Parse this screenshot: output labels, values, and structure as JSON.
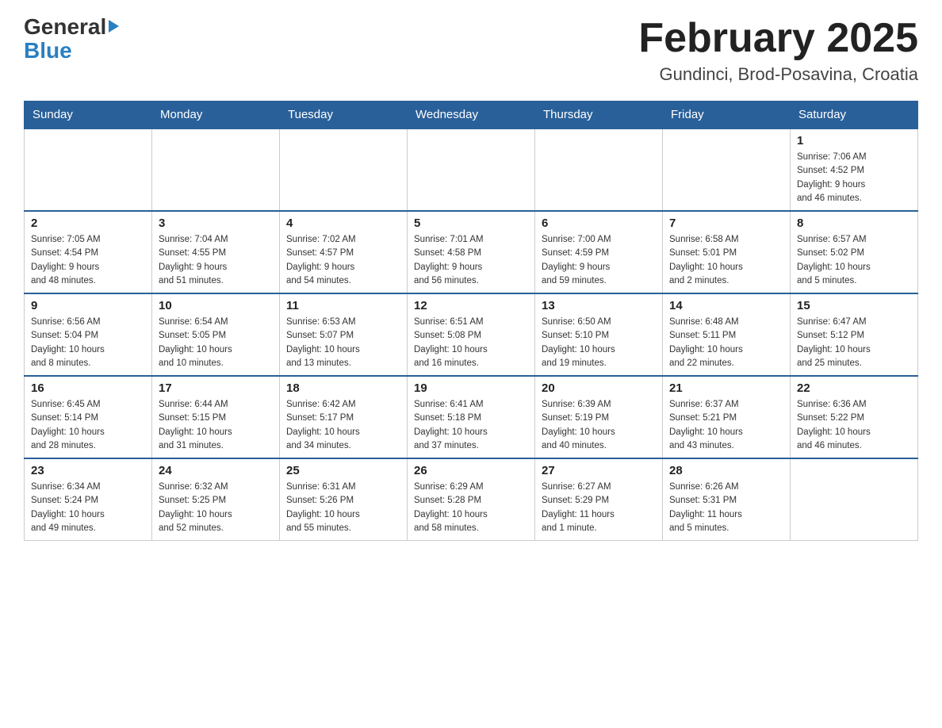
{
  "logo": {
    "general": "General",
    "blue": "Blue"
  },
  "title": "February 2025",
  "location": "Gundinci, Brod-Posavina, Croatia",
  "weekdays": [
    "Sunday",
    "Monday",
    "Tuesday",
    "Wednesday",
    "Thursday",
    "Friday",
    "Saturday"
  ],
  "weeks": [
    [
      {
        "day": "",
        "info": ""
      },
      {
        "day": "",
        "info": ""
      },
      {
        "day": "",
        "info": ""
      },
      {
        "day": "",
        "info": ""
      },
      {
        "day": "",
        "info": ""
      },
      {
        "day": "",
        "info": ""
      },
      {
        "day": "1",
        "info": "Sunrise: 7:06 AM\nSunset: 4:52 PM\nDaylight: 9 hours\nand 46 minutes."
      }
    ],
    [
      {
        "day": "2",
        "info": "Sunrise: 7:05 AM\nSunset: 4:54 PM\nDaylight: 9 hours\nand 48 minutes."
      },
      {
        "day": "3",
        "info": "Sunrise: 7:04 AM\nSunset: 4:55 PM\nDaylight: 9 hours\nand 51 minutes."
      },
      {
        "day": "4",
        "info": "Sunrise: 7:02 AM\nSunset: 4:57 PM\nDaylight: 9 hours\nand 54 minutes."
      },
      {
        "day": "5",
        "info": "Sunrise: 7:01 AM\nSunset: 4:58 PM\nDaylight: 9 hours\nand 56 minutes."
      },
      {
        "day": "6",
        "info": "Sunrise: 7:00 AM\nSunset: 4:59 PM\nDaylight: 9 hours\nand 59 minutes."
      },
      {
        "day": "7",
        "info": "Sunrise: 6:58 AM\nSunset: 5:01 PM\nDaylight: 10 hours\nand 2 minutes."
      },
      {
        "day": "8",
        "info": "Sunrise: 6:57 AM\nSunset: 5:02 PM\nDaylight: 10 hours\nand 5 minutes."
      }
    ],
    [
      {
        "day": "9",
        "info": "Sunrise: 6:56 AM\nSunset: 5:04 PM\nDaylight: 10 hours\nand 8 minutes."
      },
      {
        "day": "10",
        "info": "Sunrise: 6:54 AM\nSunset: 5:05 PM\nDaylight: 10 hours\nand 10 minutes."
      },
      {
        "day": "11",
        "info": "Sunrise: 6:53 AM\nSunset: 5:07 PM\nDaylight: 10 hours\nand 13 minutes."
      },
      {
        "day": "12",
        "info": "Sunrise: 6:51 AM\nSunset: 5:08 PM\nDaylight: 10 hours\nand 16 minutes."
      },
      {
        "day": "13",
        "info": "Sunrise: 6:50 AM\nSunset: 5:10 PM\nDaylight: 10 hours\nand 19 minutes."
      },
      {
        "day": "14",
        "info": "Sunrise: 6:48 AM\nSunset: 5:11 PM\nDaylight: 10 hours\nand 22 minutes."
      },
      {
        "day": "15",
        "info": "Sunrise: 6:47 AM\nSunset: 5:12 PM\nDaylight: 10 hours\nand 25 minutes."
      }
    ],
    [
      {
        "day": "16",
        "info": "Sunrise: 6:45 AM\nSunset: 5:14 PM\nDaylight: 10 hours\nand 28 minutes."
      },
      {
        "day": "17",
        "info": "Sunrise: 6:44 AM\nSunset: 5:15 PM\nDaylight: 10 hours\nand 31 minutes."
      },
      {
        "day": "18",
        "info": "Sunrise: 6:42 AM\nSunset: 5:17 PM\nDaylight: 10 hours\nand 34 minutes."
      },
      {
        "day": "19",
        "info": "Sunrise: 6:41 AM\nSunset: 5:18 PM\nDaylight: 10 hours\nand 37 minutes."
      },
      {
        "day": "20",
        "info": "Sunrise: 6:39 AM\nSunset: 5:19 PM\nDaylight: 10 hours\nand 40 minutes."
      },
      {
        "day": "21",
        "info": "Sunrise: 6:37 AM\nSunset: 5:21 PM\nDaylight: 10 hours\nand 43 minutes."
      },
      {
        "day": "22",
        "info": "Sunrise: 6:36 AM\nSunset: 5:22 PM\nDaylight: 10 hours\nand 46 minutes."
      }
    ],
    [
      {
        "day": "23",
        "info": "Sunrise: 6:34 AM\nSunset: 5:24 PM\nDaylight: 10 hours\nand 49 minutes."
      },
      {
        "day": "24",
        "info": "Sunrise: 6:32 AM\nSunset: 5:25 PM\nDaylight: 10 hours\nand 52 minutes."
      },
      {
        "day": "25",
        "info": "Sunrise: 6:31 AM\nSunset: 5:26 PM\nDaylight: 10 hours\nand 55 minutes."
      },
      {
        "day": "26",
        "info": "Sunrise: 6:29 AM\nSunset: 5:28 PM\nDaylight: 10 hours\nand 58 minutes."
      },
      {
        "day": "27",
        "info": "Sunrise: 6:27 AM\nSunset: 5:29 PM\nDaylight: 11 hours\nand 1 minute."
      },
      {
        "day": "28",
        "info": "Sunrise: 6:26 AM\nSunset: 5:31 PM\nDaylight: 11 hours\nand 5 minutes."
      },
      {
        "day": "",
        "info": ""
      }
    ]
  ]
}
